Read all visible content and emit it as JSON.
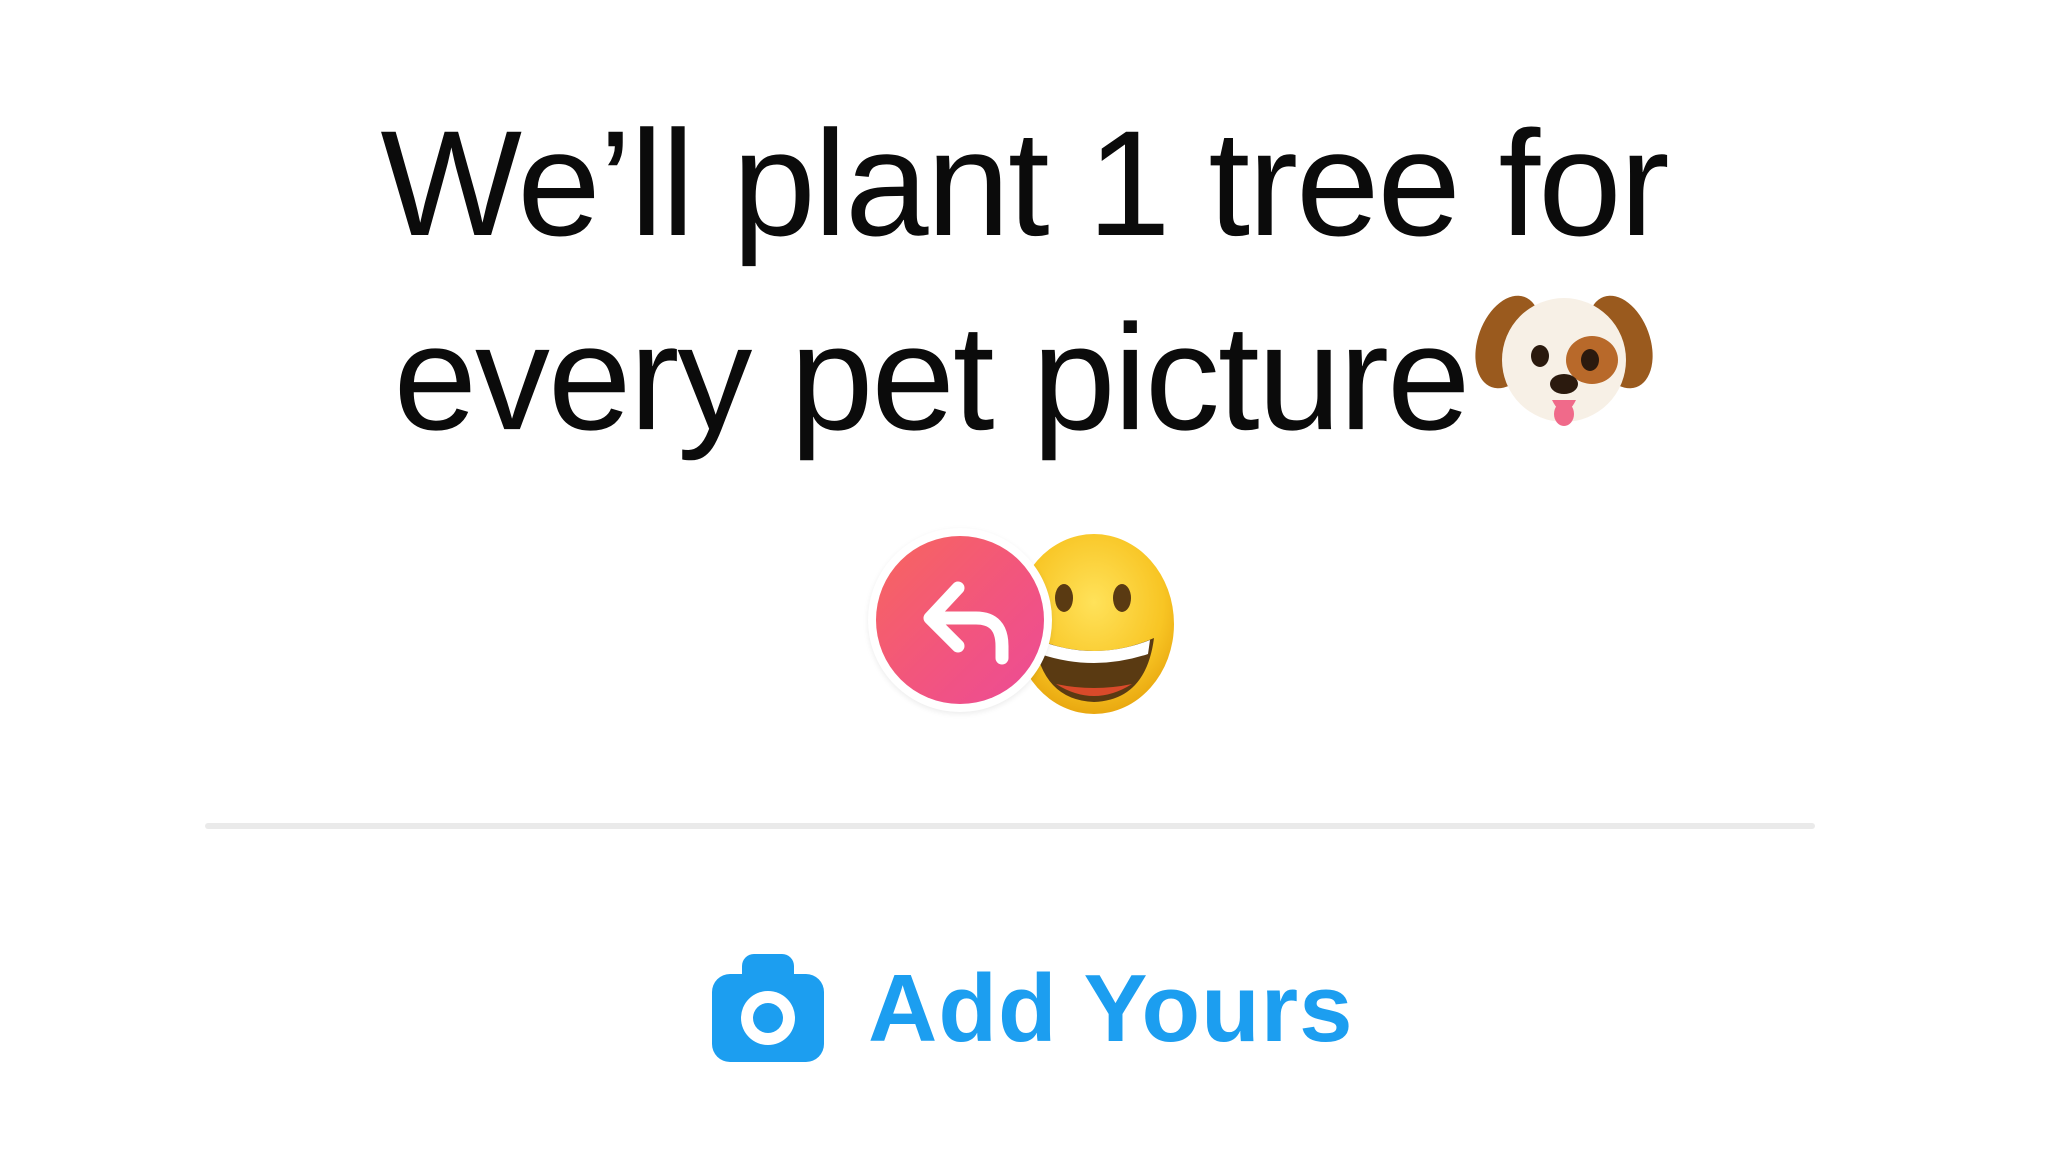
{
  "prompt": {
    "line1": "We’ll plant 1 tree for",
    "line2": "every pet picture"
  },
  "icons": {
    "dog": "dog-face-emoji",
    "smile": "grinning-face-emoji",
    "reply": "reply-arrow-icon",
    "camera": "camera-icon"
  },
  "add_yours": {
    "label": "Add Yours"
  },
  "colors": {
    "accent_blue": "#1c9ef0",
    "reply_gradient_start": "#f7665e",
    "reply_gradient_end": "#ec4b97",
    "text": "#0b0b0b",
    "divider": "#eaeaea"
  }
}
